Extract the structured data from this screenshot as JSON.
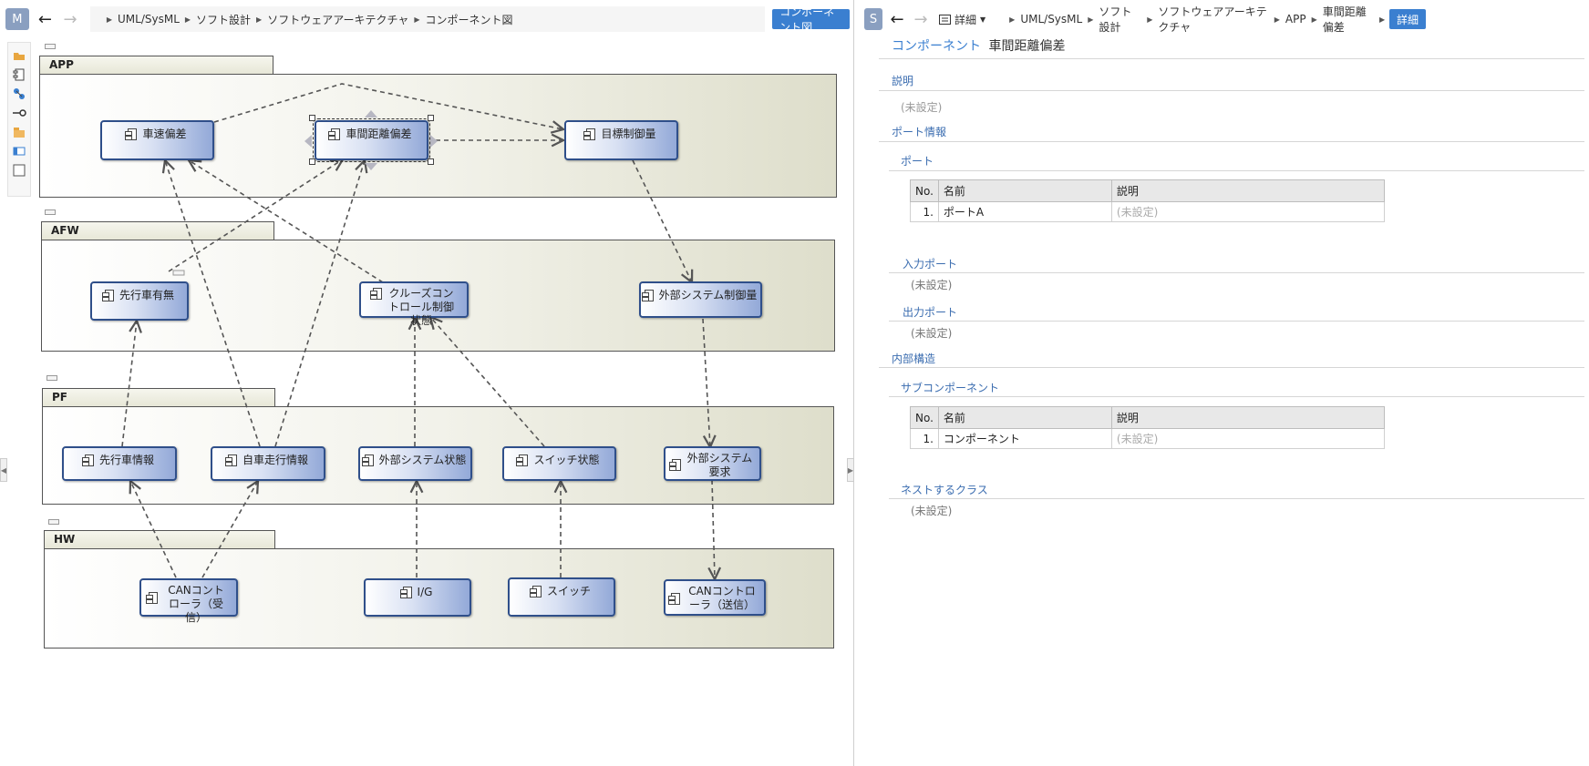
{
  "left_toolbar": {
    "badge": "M",
    "breadcrumb": [
      "UML/SysML",
      "ソフト設計",
      "ソフトウェアアーキテクチャ",
      "コンポーネント図"
    ],
    "view_button": "コンポーネント図"
  },
  "palette": {
    "icons": [
      "folder-icon",
      "component-icon",
      "connector-icon",
      "port-icon",
      "package-icon",
      "class-icon",
      "frame-icon"
    ]
  },
  "diagram": {
    "packages": {
      "app": "APP",
      "afw": "AFW",
      "pf": "PF",
      "hw": "HW"
    },
    "components": {
      "speed_dev": "車速偏差",
      "distance_dev": "車間距離偏差",
      "target_ctrl": "目標制御量",
      "preceding": "先行車有無",
      "cruise": "クルーズコントロール制御状態",
      "ext_ctrl": "外部システム制御量",
      "preceding_info": "先行車情報",
      "own_travel": "自車走行情報",
      "ext_state": "外部システム状態",
      "switch_state": "スイッチ状態",
      "ext_req": "外部システム要求",
      "can_rx": "CANコントローラ（受信）",
      "ig": "I/G",
      "switch": "スイッチ",
      "can_tx": "CANコントローラ（送信）"
    }
  },
  "right_toolbar": {
    "badge": "S",
    "view_menu": "詳細",
    "breadcrumb": [
      "UML/SysML",
      "ソフト設計",
      "ソフトウェアアーキテクチャ",
      "APP",
      "車間距離偏差"
    ],
    "detail_button": "詳細"
  },
  "detail": {
    "kind": "コンポーネント",
    "name": "車間距離偏差",
    "description_label": "説明",
    "description_value": "(未設定)",
    "port_info_label": "ポート情報",
    "ports_label": "ポート",
    "ports_table": {
      "headers": [
        "No.",
        "名前",
        "説明"
      ],
      "rows": [
        {
          "no": "1.",
          "name": "ポートA",
          "desc": "(未設定)"
        }
      ]
    },
    "in_ports_label": "入力ポート",
    "in_ports_value": "(未設定)",
    "out_ports_label": "出力ポート",
    "out_ports_value": "(未設定)",
    "internal_label": "内部構造",
    "subcomp_label": "サブコンポーネント",
    "subcomp_table": {
      "headers": [
        "No.",
        "名前",
        "説明"
      ],
      "rows": [
        {
          "no": "1.",
          "name": "コンポーネント",
          "desc": "(未設定)"
        }
      ]
    },
    "nested_label": "ネストするクラス",
    "nested_value": "(未設定)"
  }
}
